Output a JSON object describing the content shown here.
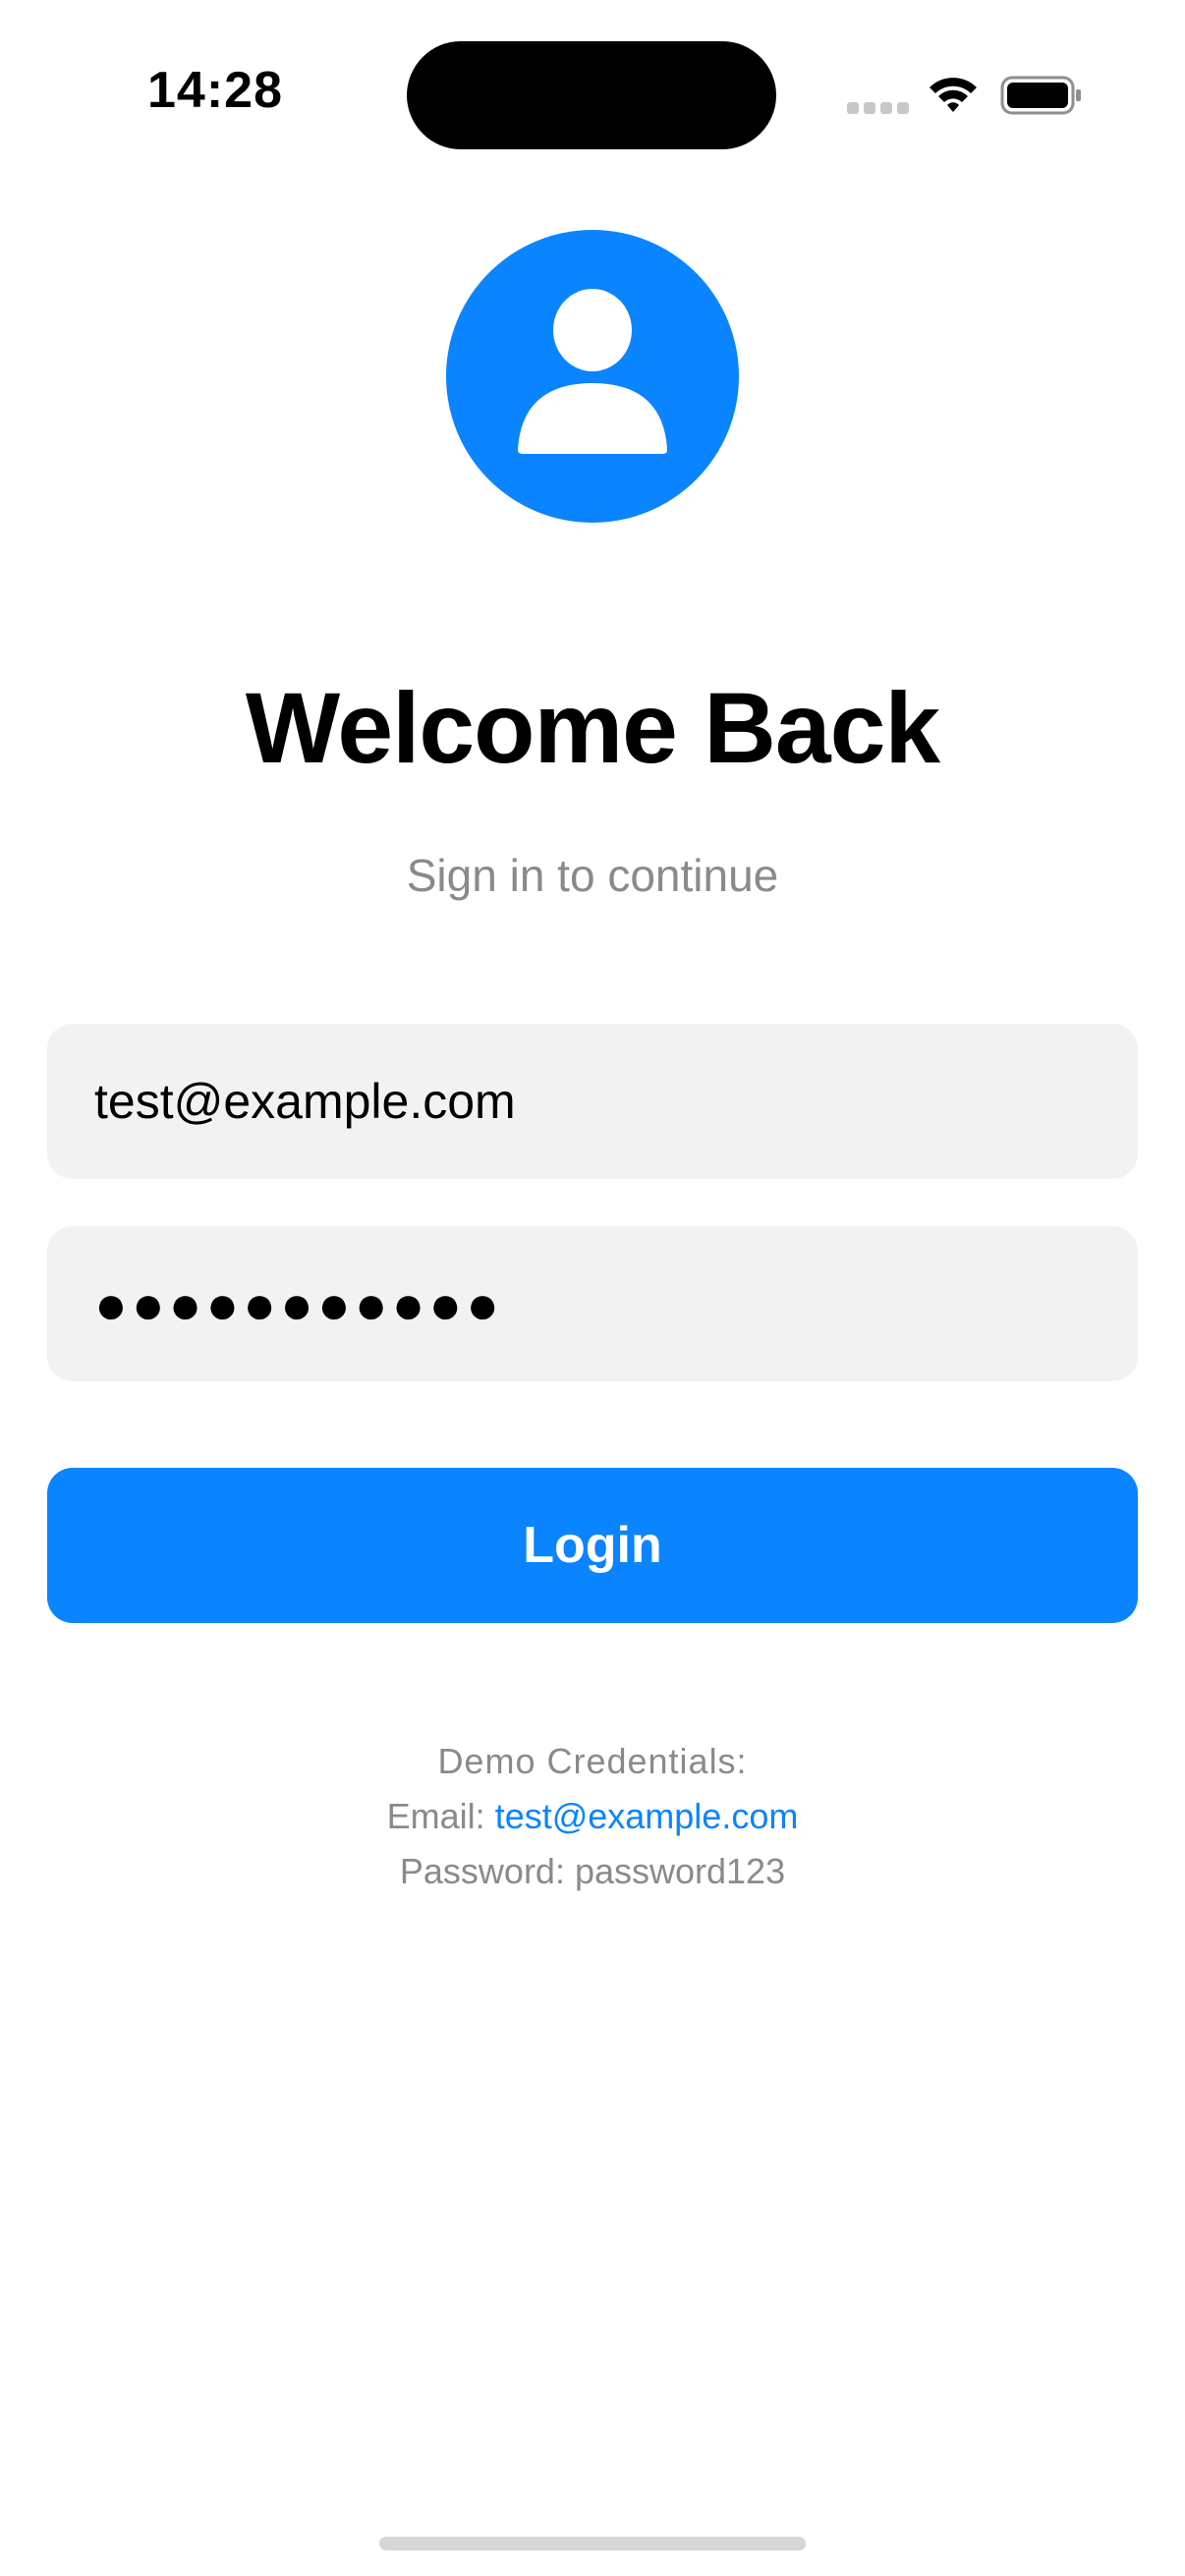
{
  "status_bar": {
    "time": "14:28",
    "icons": [
      "cellular-signal-icon",
      "wifi-icon",
      "battery-icon"
    ]
  },
  "header": {
    "avatar_icon": "person-circle-icon",
    "title": "Welcome Back",
    "subtitle": "Sign in to continue"
  },
  "form": {
    "email_value": "test@example.com",
    "password_masked": "●●●●●●●●●●●",
    "login_label": "Login"
  },
  "demo": {
    "heading": "Demo Credentials:",
    "email_label": "Email:",
    "email_value": "test@example.com",
    "password_line": "Password: password123"
  },
  "colors": {
    "accent": "#0a84ff",
    "field_background": "#f2f2f3",
    "secondary_text": "#8a8a8e"
  }
}
